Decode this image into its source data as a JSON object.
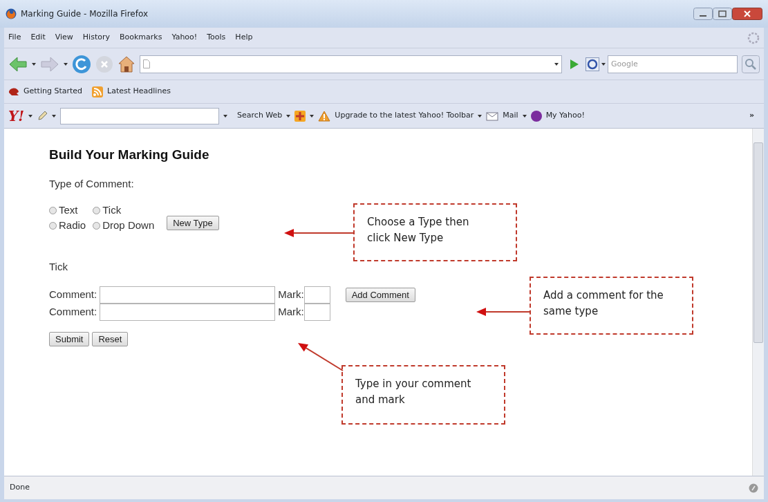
{
  "window": {
    "title": "Marking Guide - Mozilla Firefox"
  },
  "menu": [
    "File",
    "Edit",
    "View",
    "History",
    "Bookmarks",
    "Yahoo!",
    "Tools",
    "Help"
  ],
  "search": {
    "placeholder": "Google"
  },
  "bookmarks": [
    {
      "label": "Getting Started",
      "kind": "page"
    },
    {
      "label": "Latest Headlines",
      "kind": "feed"
    }
  ],
  "yahoo_toolbar": {
    "logo": "Y!",
    "search_button": "Search Web",
    "upgrade": "Upgrade to the latest Yahoo! Toolbar",
    "mail": "Mail",
    "my_yahoo": "My Yahoo!",
    "overflow": "»"
  },
  "page": {
    "heading": "Build Your Marking Guide",
    "type_label": "Type of Comment:",
    "types": [
      {
        "label": "Text",
        "selected": false
      },
      {
        "label": "Tick",
        "selected": false
      },
      {
        "label": "Radio",
        "selected": false
      },
      {
        "label": "Drop Down",
        "selected": false
      }
    ],
    "new_type_button": "New Type",
    "section": "Tick",
    "comments": [
      {
        "label": "Comment:",
        "mark_label": "Mark:"
      },
      {
        "label": "Comment:",
        "mark_label": "Mark:"
      }
    ],
    "add_button": "Add Comment",
    "submit_button": "Submit",
    "reset_button": "Reset"
  },
  "callouts": [
    {
      "text": "Choose a Type then click New Type"
    },
    {
      "text": "Add a comment for the same type"
    },
    {
      "text": "Type in your comment and mark"
    }
  ],
  "status_bar": "Done"
}
